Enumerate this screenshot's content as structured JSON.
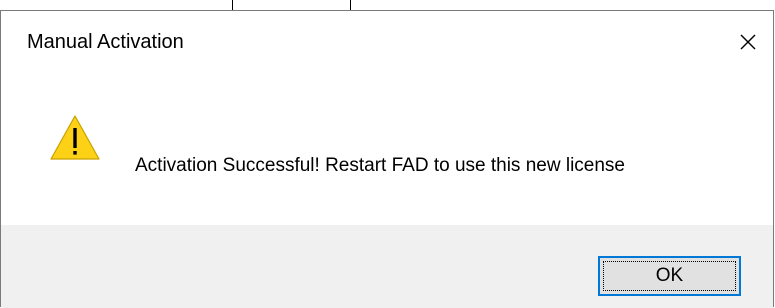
{
  "dialog": {
    "title": "Manual Activation",
    "message": "Activation Successful! Restart FAD to use this new license",
    "ok_label": "OK",
    "icon": "warning-icon",
    "close_icon": "close-icon"
  },
  "colors": {
    "footer_bg": "#f0f0f0",
    "button_bg": "#e1e1e1",
    "button_focus_border": "#0078d7",
    "warning_fill": "#fcd116"
  }
}
